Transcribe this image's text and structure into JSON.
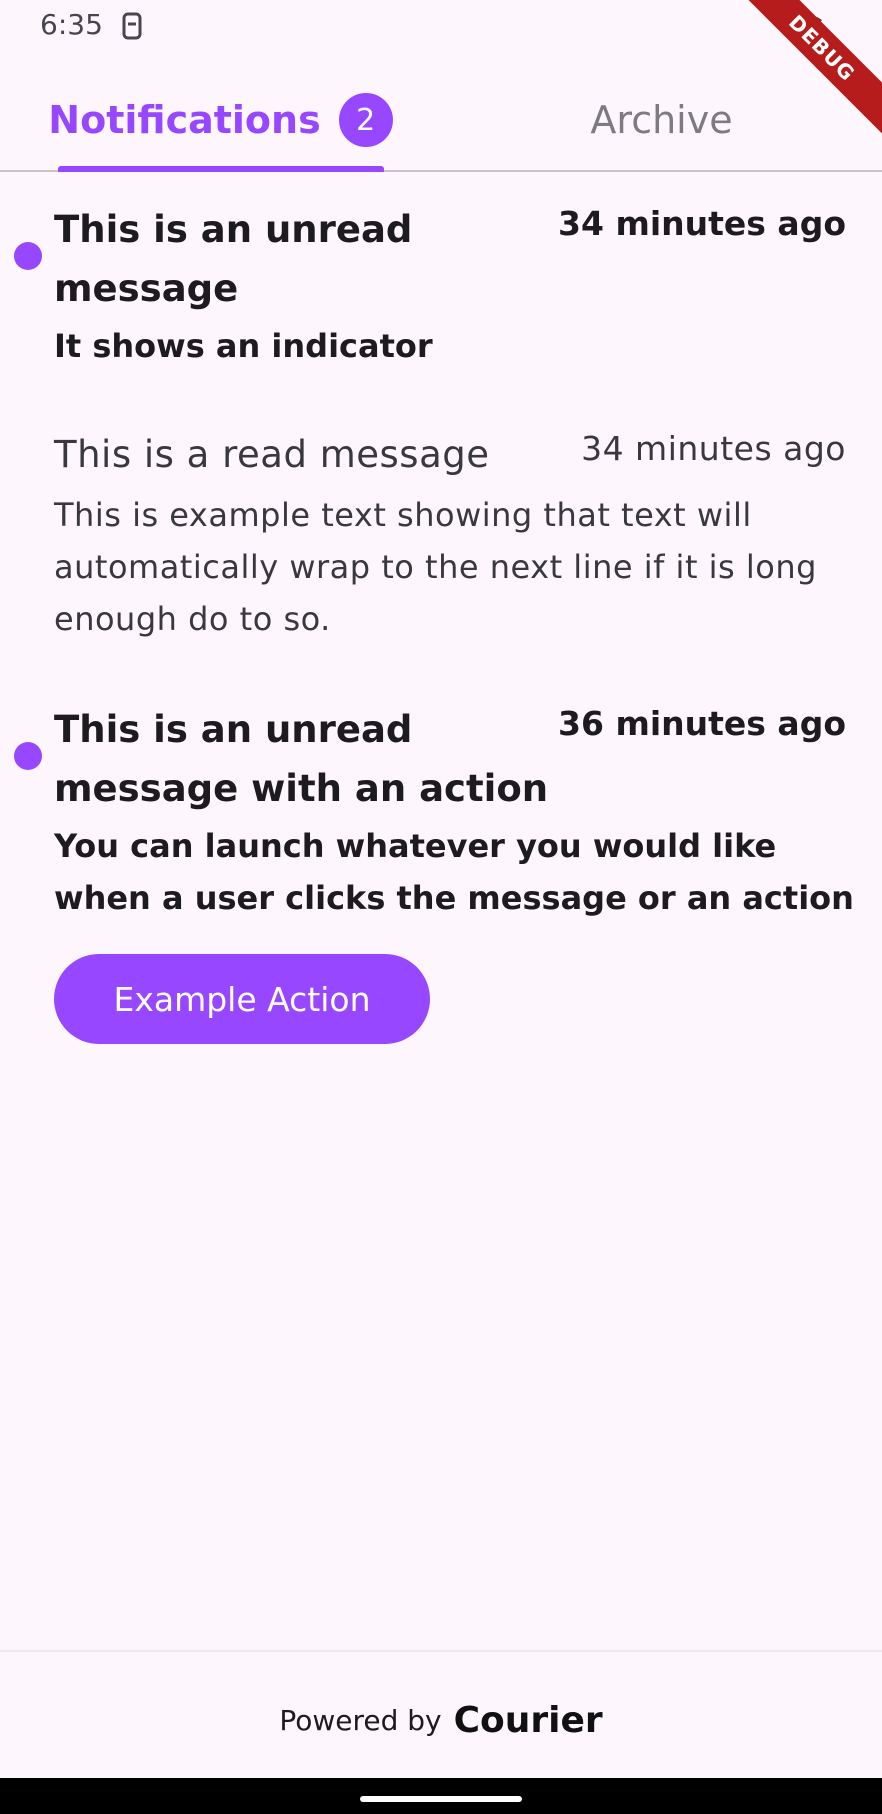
{
  "status_bar": {
    "time": "6:35"
  },
  "debug_banner": {
    "label": "DEBUG"
  },
  "tabs": {
    "notifications": {
      "label": "Notifications",
      "badge": "2"
    },
    "archive": {
      "label": "Archive"
    }
  },
  "messages": [
    {
      "title": "This is an unread message",
      "time": "34 minutes ago",
      "body": "It shows an indicator",
      "unread": true
    },
    {
      "title": "This is a read message",
      "time": "34 minutes ago",
      "body": "This is example text showing that text will automatically wrap to the next line if it is long enough do to so.",
      "unread": false
    },
    {
      "title": "This is an unread message with an action",
      "time": "36 minutes ago",
      "body": "You can launch whatever you would like when a user clicks the message or an action",
      "unread": true,
      "action_label": "Example Action"
    }
  ],
  "footer": {
    "powered_by": "Powered by",
    "brand": "Courier"
  },
  "colors": {
    "accent": "#9747ff",
    "background": "#fdf7fd"
  }
}
